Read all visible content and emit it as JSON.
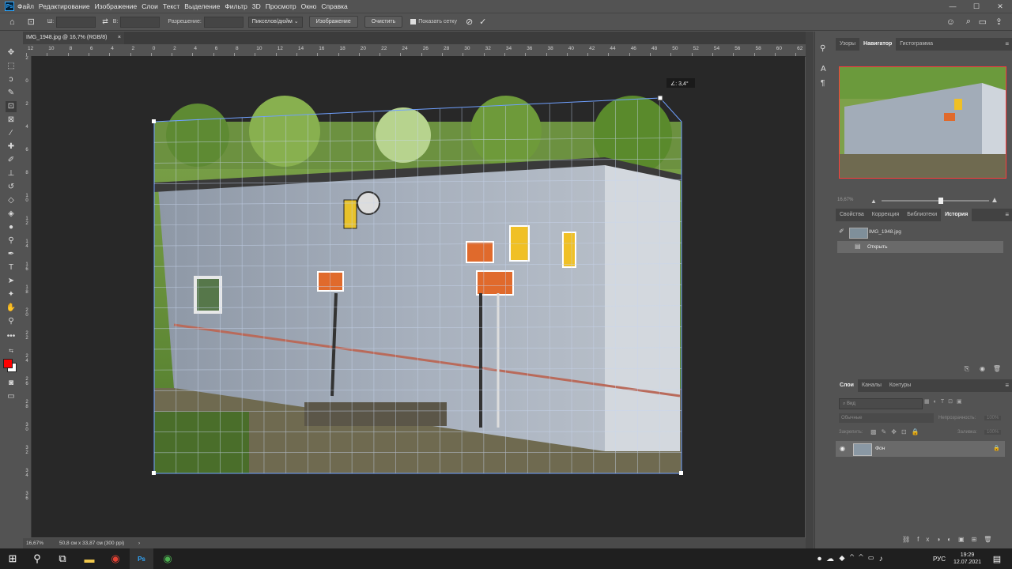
{
  "app": {
    "logo": "Ps"
  },
  "menu": [
    "Файл",
    "Редактирование",
    "Изображение",
    "Слои",
    "Текст",
    "Выделение",
    "Фильтр",
    "3D",
    "Просмотр",
    "Окно",
    "Справка"
  ],
  "options": {
    "width_label": "Ш:",
    "height_label": "В:",
    "resolution_label": "Разрешение:",
    "units": "Пикселов/дюйм",
    "image_btn": "Изображение",
    "clear_btn": "Очистить",
    "show_grid": "Показать сетку"
  },
  "document": {
    "tab": "IMG_1948.jpg @ 16,7% (RGB/8)",
    "zoom": "16,67%",
    "size_info": "50,8 см x 33,87 см (300 ppi)",
    "angle": "∠: 3,4°"
  },
  "ruler": {
    "top_labels": [
      "12",
      "10",
      "8",
      "6",
      "4",
      "2",
      "0",
      "2",
      "4",
      "6",
      "8",
      "10",
      "12",
      "14",
      "16",
      "18",
      "20",
      "22",
      "24",
      "26",
      "28",
      "30",
      "32",
      "34",
      "36",
      "38",
      "40",
      "42",
      "44",
      "46",
      "48",
      "50",
      "52",
      "54",
      "56",
      "58",
      "60",
      "62"
    ],
    "left_labels": [
      "2",
      "0",
      "2",
      "4",
      "6",
      "8",
      "1 0",
      "1 2",
      "1 4",
      "1 6",
      "1 8",
      "2 0",
      "2 2",
      "2 4",
      "2 6",
      "2 8",
      "3 0",
      "3 2",
      "3 4",
      "3 6"
    ]
  },
  "navigator": {
    "tabs": [
      "Узоры",
      "Навигатор",
      "Гистограмма"
    ],
    "active": 1,
    "zoom": "16,67%",
    "zoom_fraction": 0.55
  },
  "history": {
    "tabs": [
      "Свойства",
      "Коррекция",
      "Библиотеки",
      "История"
    ],
    "active": 3,
    "snapshot": "IMG_1948.jpg",
    "items": [
      "Открыть"
    ]
  },
  "layers": {
    "tabs": [
      "Слои",
      "Каналы",
      "Контуры"
    ],
    "active": 0,
    "search": "Вид",
    "blend": "Обычные",
    "opacity_label": "Непрозрачность:",
    "opacity": "100%",
    "lock_label": "Закрепить:",
    "fill_label": "Заливка:",
    "fill": "100%",
    "layer_name": "Фон"
  },
  "taskbar": {
    "lang": "РУС",
    "time": "19:29",
    "date": "12.07.2021"
  },
  "colors": {
    "foreground": "#ff0000",
    "background": "#ffffff",
    "accent": "#31a8ff"
  }
}
